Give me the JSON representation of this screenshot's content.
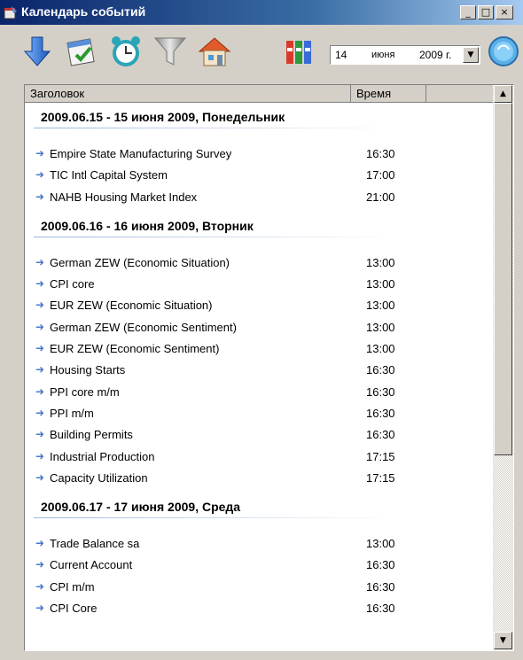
{
  "window": {
    "title": "Календарь событий",
    "controls": [
      "_",
      "□",
      "×"
    ]
  },
  "toolbar": {
    "buttons": [
      {
        "icon": "download-arrow-icon"
      },
      {
        "icon": "calendar-check-icon"
      },
      {
        "icon": "alarm-clock-icon"
      },
      {
        "icon": "filter-funnel-icon"
      },
      {
        "icon": "home-icon"
      },
      {
        "icon": "binders-icon"
      }
    ],
    "date": {
      "day": "14",
      "month": "июня",
      "year": "2009 г."
    }
  },
  "list": {
    "columns": [
      "Заголовок",
      "Время"
    ],
    "groups": [
      {
        "title": "2009.06.15 - 15 июня 2009, Понедельник",
        "events": [
          {
            "name": "Empire State Manufacturing Survey",
            "time": "16:30"
          },
          {
            "name": "TIC Intl Capital System",
            "time": "17:00"
          },
          {
            "name": "NAHB Housing Market Index",
            "time": "21:00"
          }
        ]
      },
      {
        "title": "2009.06.16 - 16 июня 2009, Вторник",
        "events": [
          {
            "name": "German ZEW (Economic Situation)",
            "time": "13:00"
          },
          {
            "name": "CPI core",
            "time": "13:00"
          },
          {
            "name": "EUR ZEW (Economic Situation)",
            "time": "13:00"
          },
          {
            "name": "German ZEW (Economic Sentiment)",
            "time": "13:00"
          },
          {
            "name": "EUR ZEW (Economic Sentiment)",
            "time": "13:00"
          },
          {
            "name": "Housing Starts",
            "time": "16:30"
          },
          {
            "name": "PPI core m/m",
            "time": "16:30"
          },
          {
            "name": "PPI m/m",
            "time": "16:30"
          },
          {
            "name": "Building Permits",
            "time": "16:30"
          },
          {
            "name": "Industrial Production",
            "time": "17:15"
          },
          {
            "name": "Capacity Utilization",
            "time": "17:15"
          }
        ]
      },
      {
        "title": "2009.06.17 - 17 июня 2009, Среда",
        "events": [
          {
            "name": "Trade Balance sa",
            "time": "13:00"
          },
          {
            "name": "Current Account",
            "time": "16:30"
          },
          {
            "name": "CPI m/m",
            "time": "16:30"
          },
          {
            "name": "CPI Core",
            "time": "16:30"
          }
        ]
      }
    ]
  },
  "colors": {
    "title_bar_start": "#0a246a",
    "title_bar_end": "#a6caf0",
    "arrow": "#4a78c8"
  }
}
